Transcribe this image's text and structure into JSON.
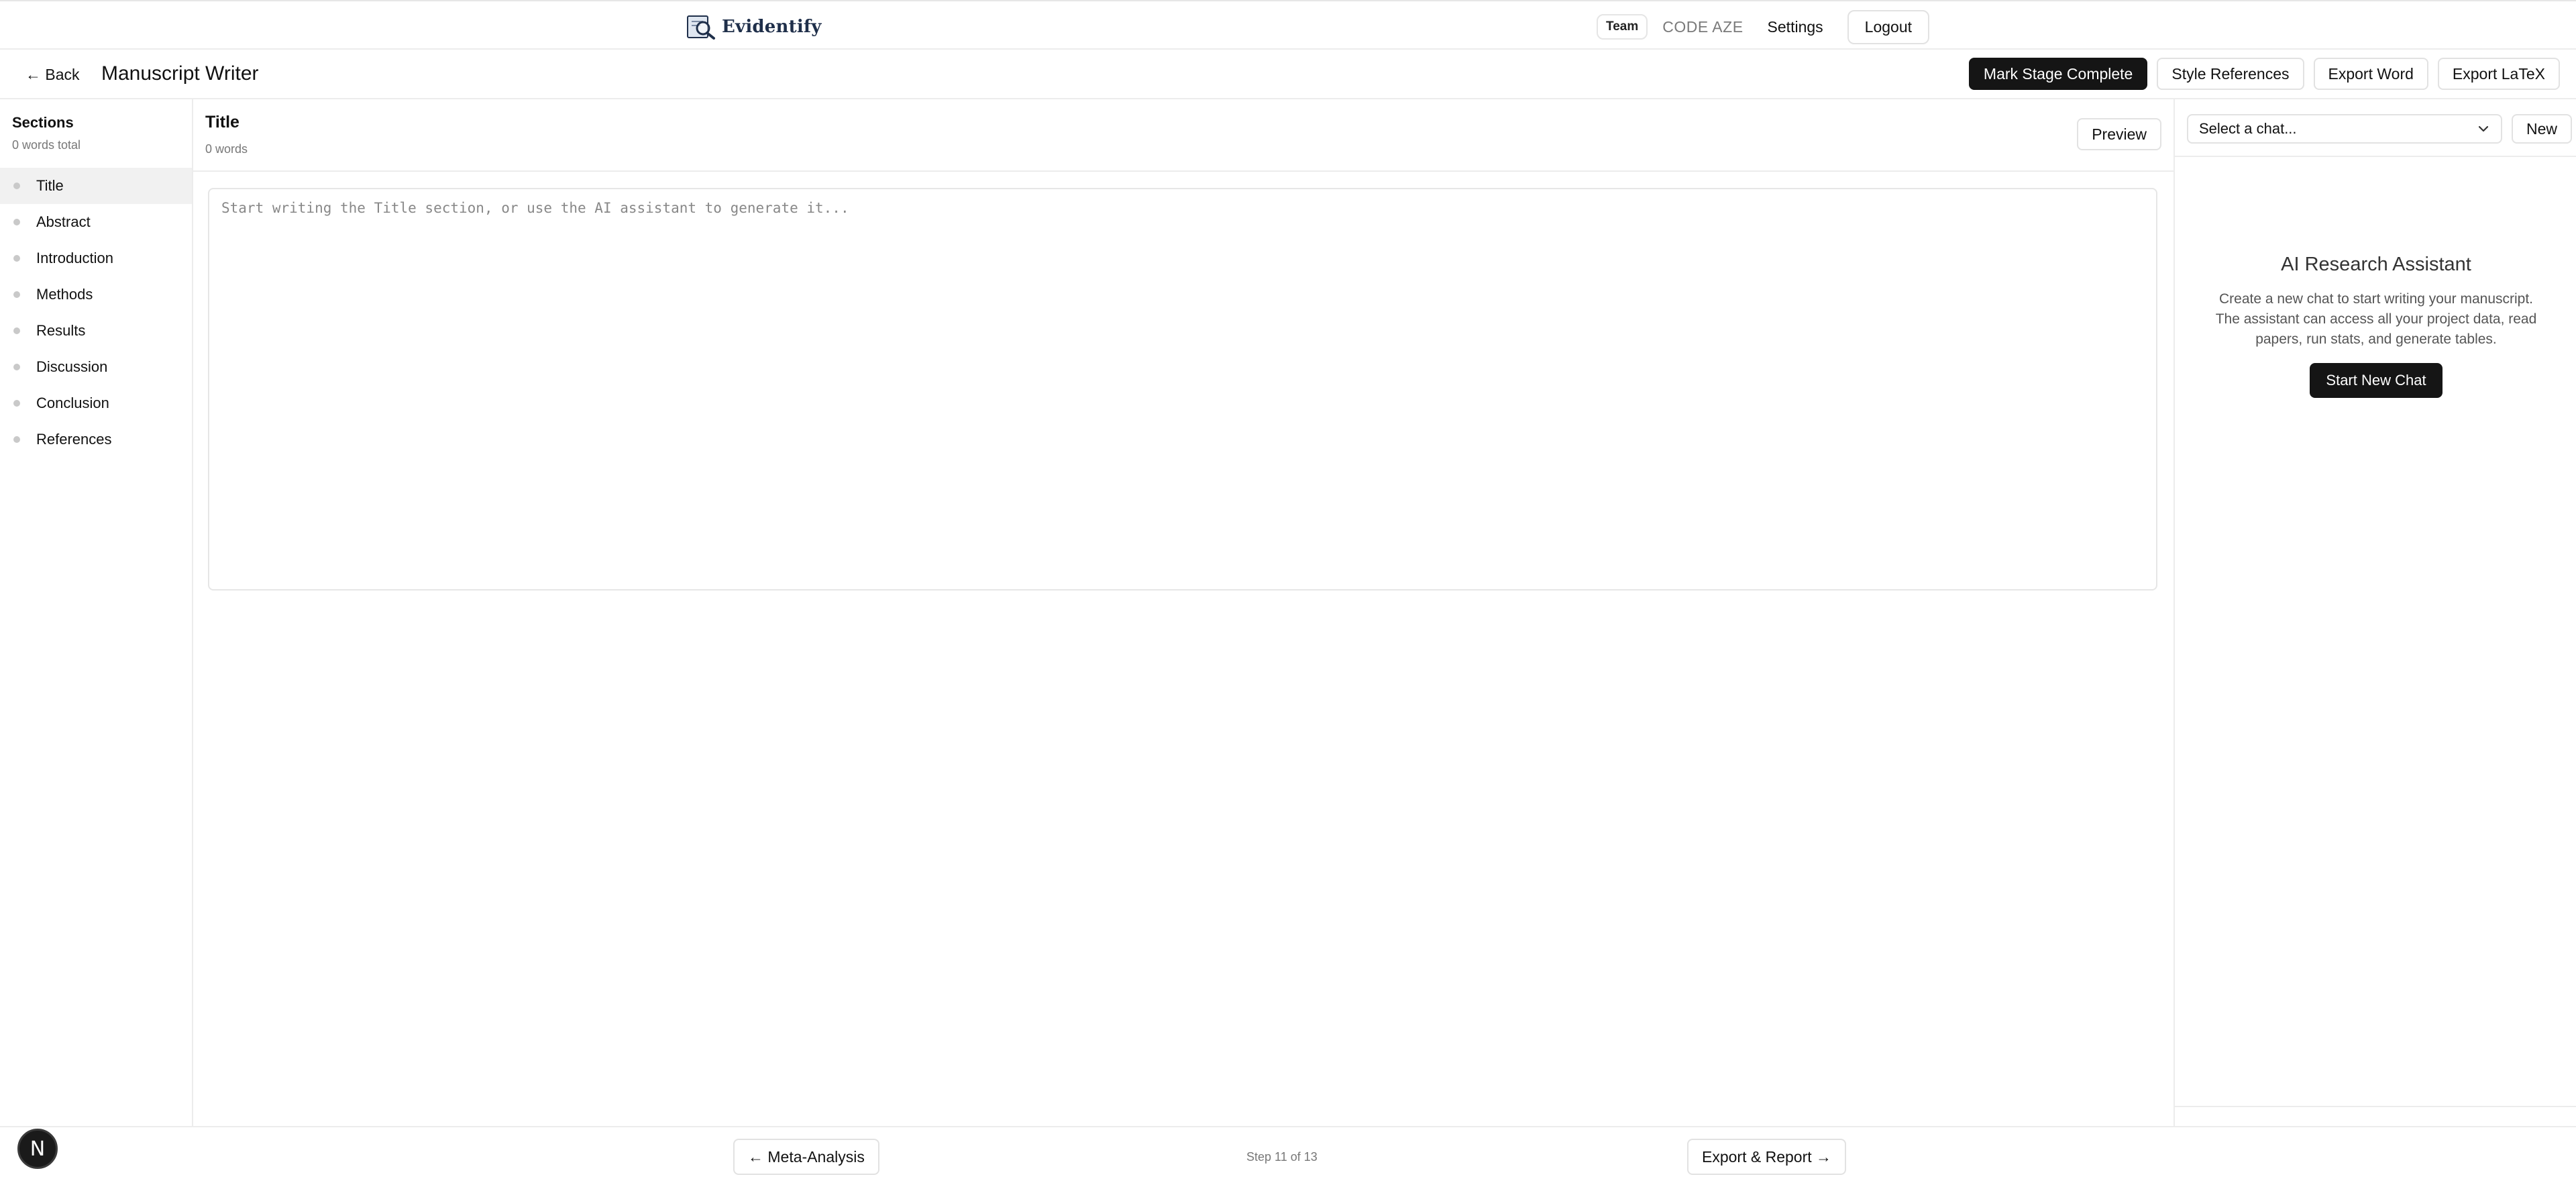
{
  "brand": {
    "name": "Evidentify"
  },
  "topnav": {
    "team_badge": "Team",
    "team_name": "CODE AZE",
    "settings": "Settings",
    "logout": "Logout"
  },
  "subbar": {
    "back": "← Back",
    "title": "Manuscript Writer",
    "actions": {
      "mark_complete": "Mark Stage Complete",
      "style_refs": "Style References",
      "export_word": "Export Word",
      "export_latex": "Export LaTeX"
    }
  },
  "sidebar": {
    "title": "Sections",
    "subtitle": "0 words total",
    "items": [
      {
        "label": "Title",
        "active": true
      },
      {
        "label": "Abstract"
      },
      {
        "label": "Introduction"
      },
      {
        "label": "Methods"
      },
      {
        "label": "Results"
      },
      {
        "label": "Discussion"
      },
      {
        "label": "Conclusion"
      },
      {
        "label": "References"
      }
    ]
  },
  "editor": {
    "title": "Title",
    "words": "0 words",
    "preview": "Preview",
    "placeholder": "Start writing the Title section, or use the AI assistant to generate it..."
  },
  "chat": {
    "select_placeholder": "Select a chat...",
    "new": "New",
    "assistant_title": "AI Research Assistant",
    "assistant_desc": "Create a new chat to start writing your manuscript. The assistant can access all your project data, read papers, run stats, and generate tables.",
    "start": "Start New Chat"
  },
  "footer": {
    "prev": "← Meta-Analysis",
    "step": "Step 11 of 13",
    "next": "Export & Report →"
  },
  "dev_badge": "N",
  "colors": {
    "primary": "#151515",
    "border": "#e2e2e2",
    "muted": "#777777",
    "brand": "#1f2f4a"
  },
  "icons": {
    "brand": "magnifier-book-icon",
    "select": "chevron-down-icon"
  }
}
